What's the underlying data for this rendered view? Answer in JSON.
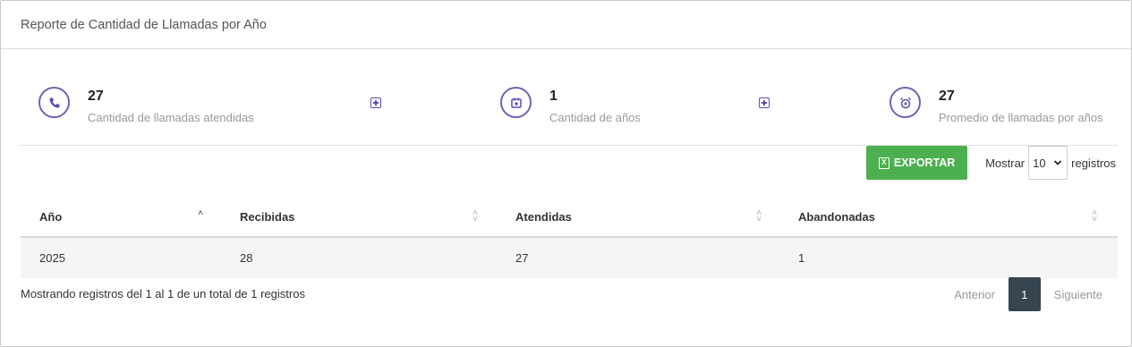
{
  "header": {
    "title": "Reporte de Cantidad de Llamadas por Año"
  },
  "stats": [
    {
      "icon": "phone-icon",
      "value": "27",
      "label": "Cantidad de llamadas atendidas"
    },
    {
      "icon": "calendar-icon",
      "value": "1",
      "label": "Cantidad de años"
    },
    {
      "icon": "alarm-clock-icon",
      "value": "27",
      "label": "Promedio de llamadas por años"
    }
  ],
  "toolbar": {
    "export_label": "EXPORTAR",
    "show_label": "Mostrar",
    "page_size": "10",
    "records_label": "registros"
  },
  "table": {
    "columns": [
      "Año",
      "Recibidas",
      "Atendidas",
      "Abandonadas"
    ],
    "rows": [
      [
        "2025",
        "28",
        "27",
        "1"
      ]
    ]
  },
  "footer": {
    "info": "Mostrando registros del 1 al 1 de un total de 1 registros",
    "prev": "Anterior",
    "page": "1",
    "next": "Siguiente"
  },
  "colors": {
    "accent": "#6c63b5",
    "export": "#4caf50",
    "active_page": "#36454f"
  }
}
